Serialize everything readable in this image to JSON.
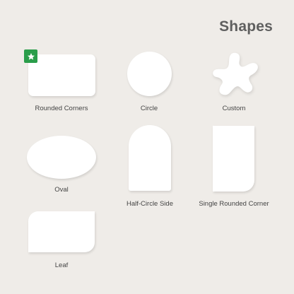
{
  "header": {
    "title": "Shapes"
  },
  "colors": {
    "background": "#efece8",
    "shape_fill": "#ffffff",
    "selected_badge": "#2a9d4a"
  },
  "selected_shape": "Rounded Corners",
  "shapes": [
    {
      "label": "Rounded Corners",
      "icon": "rounded-rectangle"
    },
    {
      "label": "Circle",
      "icon": "circle"
    },
    {
      "label": "Custom",
      "icon": "blob"
    },
    {
      "label": "Oval",
      "icon": "ellipse"
    },
    {
      "label": "Half-Circle Side",
      "icon": "arch"
    },
    {
      "label": "Single Rounded Corner",
      "icon": "single-rounded-corner-rectangle"
    },
    {
      "label": "Leaf",
      "icon": "leaf"
    }
  ]
}
